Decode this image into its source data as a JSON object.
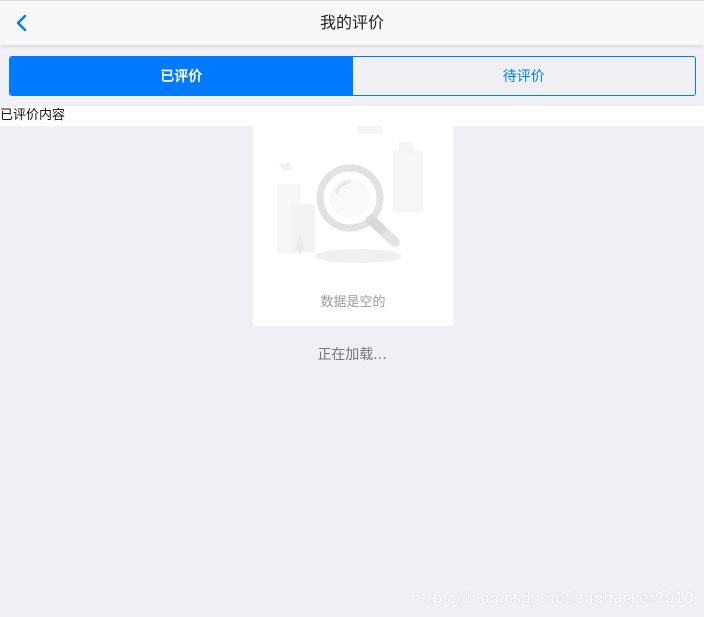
{
  "navbar": {
    "title": "我的评价",
    "back_icon": "chevron-left-icon"
  },
  "tabs": [
    {
      "label": "已评价",
      "active": true
    },
    {
      "label": "待评价",
      "active": false
    }
  ],
  "content": {
    "label": "已评价内容"
  },
  "empty_state": {
    "icon": "magnifier-empty-icon",
    "text": "数据是空的"
  },
  "loading": {
    "text": "正在加载..."
  },
  "watermark": {
    "text": "https://blog.csdn.net/zgphacker2010"
  },
  "colors": {
    "accent": "#007aff",
    "background": "#efeff4"
  }
}
